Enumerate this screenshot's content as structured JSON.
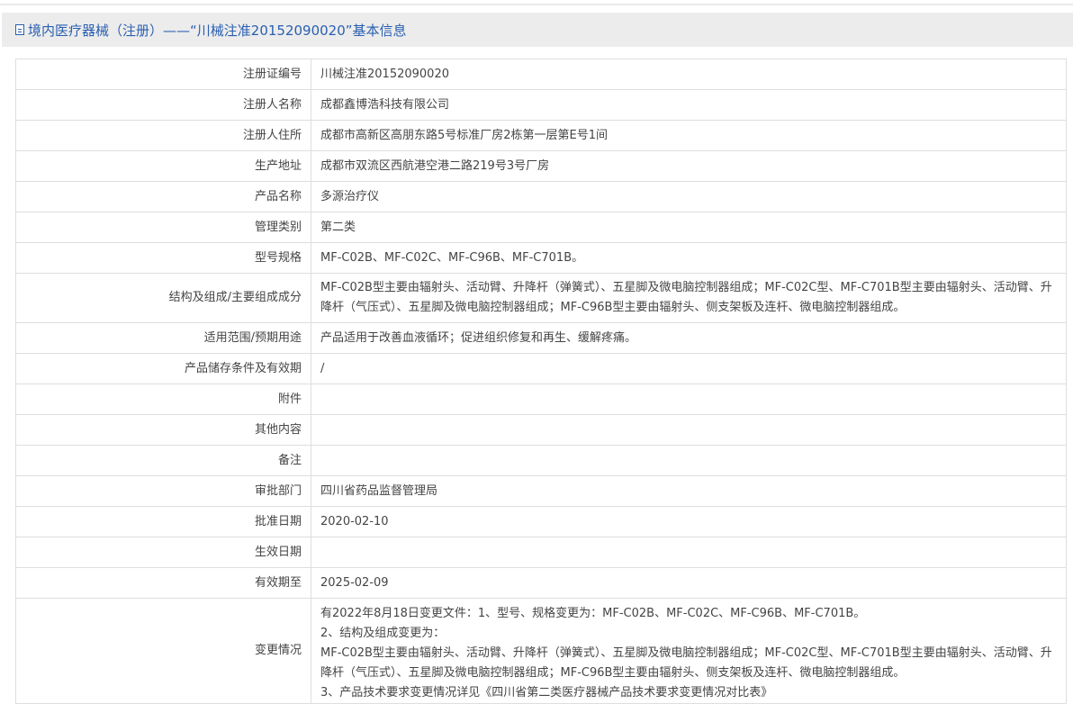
{
  "header": {
    "icon": "document-icon",
    "title": "境内医疗器械（注册）——“川械注准20152090020”基本信息"
  },
  "rows": [
    {
      "label": "注册证编号",
      "value": "川械注准20152090020"
    },
    {
      "label": "注册人名称",
      "value": "成都鑫博浩科技有限公司"
    },
    {
      "label": "注册人住所",
      "value": "成都市高新区高朋东路5号标准厂房2栋第一层第E号1间"
    },
    {
      "label": "生产地址",
      "value": "成都市双流区西航港空港二路219号3号厂房"
    },
    {
      "label": "产品名称",
      "value": "多源治疗仪"
    },
    {
      "label": "管理类别",
      "value": "第二类"
    },
    {
      "label": "型号规格",
      "value": "MF-C02B、MF-C02C、MF-C96B、MF-C701B。"
    },
    {
      "label": "结构及组成/主要组成成分",
      "value": "MF-C02B型主要由辐射头、活动臂、升降杆（弹簧式）、五星脚及微电脑控制器组成；MF-C02C型、MF-C701B型主要由辐射头、活动臂、升降杆（气压式）、五星脚及微电脑控制器组成；MF-C96B型主要由辐射头、侧支架板及连杆、微电脑控制器组成。"
    },
    {
      "label": "适用范围/预期用途",
      "value": "产品适用于改善血液循环；促进组织修复和再生、缓解疼痛。"
    },
    {
      "label": "产品储存条件及有效期",
      "value": "/"
    },
    {
      "label": "附件",
      "value": ""
    },
    {
      "label": "其他内容",
      "value": ""
    },
    {
      "label": "备注",
      "value": ""
    },
    {
      "label": "审批部门",
      "value": "四川省药品监督管理局"
    },
    {
      "label": "批准日期",
      "value": "2020-02-10"
    },
    {
      "label": "生效日期",
      "value": ""
    },
    {
      "label": "有效期至",
      "value": "2025-02-09"
    }
  ],
  "change": {
    "label": "变更情况",
    "lines": [
      "有2022年8月18日变更文件：1、型号、规格变更为：MF-C02B、MF-C02C、MF-C96B、MF-C701B。",
      "2、结构及组成变更为：",
      "MF-C02B型主要由辐射头、活动臂、升降杆（弹簧式）、五星脚及微电脑控制器组成；MF-C02C型、MF-C701B型主要由辐射头、活动臂、升降杆（气压式）、五星脚及微电脑控制器组成；MF-C96B型主要由辐射头、侧支架板及连杆、微电脑控制器组成。",
      "3、产品技术要求变更情况详见《四川省第二类医疗器械产品技术要求变更情况对比表》"
    ]
  }
}
